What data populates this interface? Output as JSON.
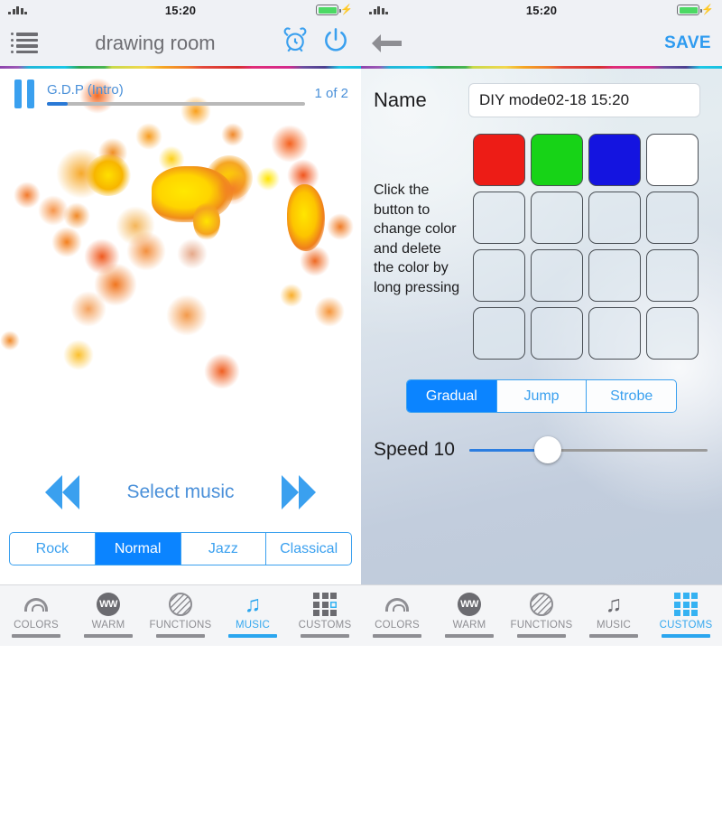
{
  "status": {
    "time": "15:20",
    "battery_icon": "battery-charging-icon",
    "signal_icon": "signal-bars-icon"
  },
  "colors": {
    "accent_blue": "#3aa0ef",
    "selected_blue": "#0b84ff",
    "tab_active": "#2ba6ef",
    "inactive_gray": "#8e8e93",
    "battery_green": "#4cd964"
  },
  "left": {
    "nav": {
      "menu_icon": "list-menu-icon",
      "title": "drawing room",
      "alarm_icon": "alarm-clock-icon",
      "power_icon": "power-icon"
    },
    "player": {
      "pause_icon": "pause-icon",
      "track": "G.D.P (Intro)",
      "counter": "1 of 2",
      "progress_percent": 8
    },
    "transport": {
      "prev_icon": "rewind-icon",
      "label": "Select music",
      "next_icon": "fast-forward-icon"
    },
    "presets": [
      {
        "label": "Rock",
        "selected": false
      },
      {
        "label": "Normal",
        "selected": true
      },
      {
        "label": "Jazz",
        "selected": false
      },
      {
        "label": "Classical",
        "selected": false
      }
    ],
    "tabs": [
      {
        "label": "COLORS",
        "icon": "rainbow-icon",
        "active": false
      },
      {
        "label": "WARM",
        "icon": "warm-white-icon",
        "icon_text": "WW",
        "active": false
      },
      {
        "label": "FUNCTIONS",
        "icon": "hatched-circle-icon",
        "active": false
      },
      {
        "label": "MUSIC",
        "icon": "music-note-icon",
        "active": true
      },
      {
        "label": "CUSTOMS",
        "icon": "grid-icon",
        "active": false
      }
    ]
  },
  "right": {
    "nav": {
      "back_icon": "back-arrow-icon",
      "save_label": "SAVE"
    },
    "name": {
      "label": "Name",
      "value": "DIY mode02-18 15:20",
      "placeholder": "Name"
    },
    "hint": "Click the button to change color and delete the color by long pressing",
    "color_grid": {
      "rows": 4,
      "cols": 4,
      "cells": [
        "#ed1c16",
        "#17d317",
        "#1414e0",
        "#ffffff",
        "",
        "",
        "",
        "",
        "",
        "",
        "",
        "",
        "",
        "",
        "",
        ""
      ]
    },
    "modes": [
      {
        "label": "Gradual",
        "selected": true
      },
      {
        "label": "Jump",
        "selected": false
      },
      {
        "label": "Strobe",
        "selected": false
      }
    ],
    "speed": {
      "label": "Speed 10",
      "value": 10,
      "percent": 33
    },
    "tabs": [
      {
        "label": "COLORS",
        "icon": "rainbow-icon",
        "active": false
      },
      {
        "label": "WARM",
        "icon": "warm-white-icon",
        "icon_text": "WW",
        "active": false
      },
      {
        "label": "FUNCTIONS",
        "icon": "hatched-circle-icon",
        "active": false
      },
      {
        "label": "MUSIC",
        "icon": "music-note-icon",
        "active": false
      },
      {
        "label": "CUSTOMS",
        "icon": "grid-icon",
        "active": true
      }
    ]
  }
}
